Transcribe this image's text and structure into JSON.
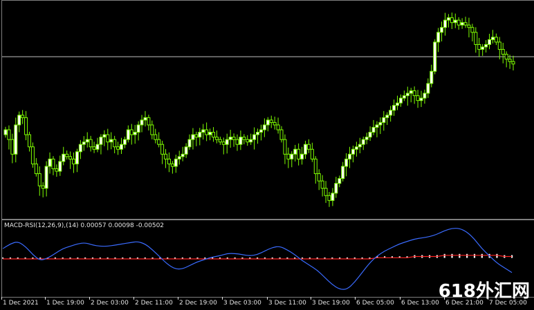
{
  "indicator": {
    "label": "MACD-RSI(12,26,9),(14) 0.00057 0.00098 -0.00502",
    "line_color": "#3a6bff",
    "signal_color": "#ff2020",
    "histogram_color": "#ffffff"
  },
  "candles": {
    "bull_color": "#ffffff",
    "bear_color": "#000000",
    "outline_color": "#7fff00",
    "count": 148,
    "closes": [
      1.132,
      1.13,
      1.127,
      1.133,
      1.135,
      1.1345,
      1.131,
      1.1285,
      1.125,
      1.123,
      1.1205,
      1.12,
      1.1245,
      1.126,
      1.124,
      1.1235,
      1.1255,
      1.127,
      1.1265,
      1.126,
      1.125,
      1.1275,
      1.129,
      1.1295,
      1.13,
      1.1285,
      1.128,
      1.129,
      1.1305,
      1.131,
      1.1295,
      1.13,
      1.1285,
      1.128,
      1.129,
      1.13,
      1.132,
      1.131,
      1.1315,
      1.133,
      1.134,
      1.1345,
      1.133,
      1.131,
      1.13,
      1.129,
      1.127,
      1.126,
      1.125,
      1.1245,
      1.126,
      1.1265,
      1.127,
      1.1285,
      1.13,
      1.131,
      1.1305,
      1.1315,
      1.132,
      1.131,
      1.1315,
      1.1305,
      1.13,
      1.1295,
      1.129,
      1.13,
      1.1305,
      1.13,
      1.129,
      1.1305,
      1.13,
      1.1295,
      1.13,
      1.131,
      1.1315,
      1.132,
      1.133,
      1.134,
      1.1335,
      1.133,
      1.132,
      1.13,
      1.127,
      1.126,
      1.127,
      1.128,
      1.126,
      1.127,
      1.129,
      1.128,
      1.126,
      1.123,
      1.1215,
      1.12,
      1.1185,
      1.1175,
      1.119,
      1.121,
      1.122,
      1.1245,
      1.126,
      1.127,
      1.128,
      1.1285,
      1.129,
      1.13,
      1.1305,
      1.1315,
      1.1325,
      1.133,
      1.1335,
      1.1345,
      1.135,
      1.136,
      1.137,
      1.1375,
      1.1385,
      1.139,
      1.1395,
      1.14,
      1.139,
      1.138,
      1.1385,
      1.1395,
      1.1415,
      1.144,
      1.15,
      1.152,
      1.153,
      1.1545,
      1.155,
      1.154,
      1.1545,
      1.1535,
      1.154,
      1.1535,
      1.153,
      1.152,
      1.1495,
      1.1485,
      1.149,
      1.1495,
      1.1505,
      1.151,
      1.15,
      1.1485,
      1.1475,
      1.1465,
      1.146,
      1.1455
    ],
    "price_line": 1.147
  },
  "macd": {
    "values": [
      0.0008,
      0.0012,
      0.0014,
      0.001,
      0.0003,
      -0.0002,
      0.0,
      0.0004,
      0.0008,
      0.001,
      0.0012,
      0.0013,
      0.0011,
      0.001,
      0.001,
      0.0011,
      0.0012,
      0.0013,
      0.0014,
      0.0012,
      0.0007,
      0.0001,
      -0.0005,
      -0.0009,
      -0.0009,
      -0.0006,
      -0.0003,
      -0.0001,
      0.0001,
      0.0002,
      0.0004,
      0.0004,
      0.0003,
      0.0002,
      0.0003,
      0.0006,
      0.0009,
      0.001,
      0.0007,
      0.0003,
      -0.0002,
      -0.0006,
      -0.001,
      -0.0016,
      -0.0022,
      -0.0026,
      -0.0026,
      -0.002,
      -0.0012,
      -0.0004,
      0.0002,
      0.0006,
      0.0009,
      0.0012,
      0.0014,
      0.0016,
      0.0017,
      0.0018,
      0.002,
      0.0023,
      0.0025,
      0.0025,
      0.0022,
      0.0016,
      0.0008,
      0.0002,
      -0.0004,
      -0.0008,
      -0.0012
    ],
    "signal_values": [
      0.0,
      0.0,
      0.0,
      0.0,
      0.0,
      0.0,
      0.0,
      0.0,
      0.0,
      0.0,
      0.0,
      0.0,
      0.0,
      0.0,
      0.0,
      0.0,
      0.0,
      0.0,
      0.0,
      0.0,
      0.0,
      0.0,
      0.0,
      0.0,
      0.0,
      0.0,
      0.0,
      0.0,
      0.0,
      0.0,
      0.0,
      0.0,
      0.0,
      0.0,
      0.0,
      0.0,
      0.0,
      0.0,
      0.0,
      0.0,
      0.0,
      0.0,
      0.0,
      0.0,
      0.0,
      0.0,
      0.0,
      0.0,
      0.0,
      0.0,
      0.0001,
      0.0001,
      0.0001,
      0.0001,
      0.0001,
      0.0002,
      0.0002,
      0.0002,
      0.0002,
      0.0003,
      0.0003,
      0.0003,
      0.0003,
      0.0003,
      0.0003,
      0.0003,
      0.0003,
      0.0002,
      0.0002
    ]
  },
  "time_axis": {
    "labels": [
      "1 Dec 2021",
      "1 Dec 19:00",
      "2 Dec 03:00",
      "2 Dec 11:00",
      "2 Dec 19:00",
      "3 Dec 03:00",
      "3 Dec 11:00",
      "3 Dec 19:00",
      "6 Dec 05:00",
      "6 Dec 13:00",
      "6 Dec 21:00",
      "7 Dec 05:00"
    ]
  },
  "watermark": {
    "text": "618外汇网"
  }
}
